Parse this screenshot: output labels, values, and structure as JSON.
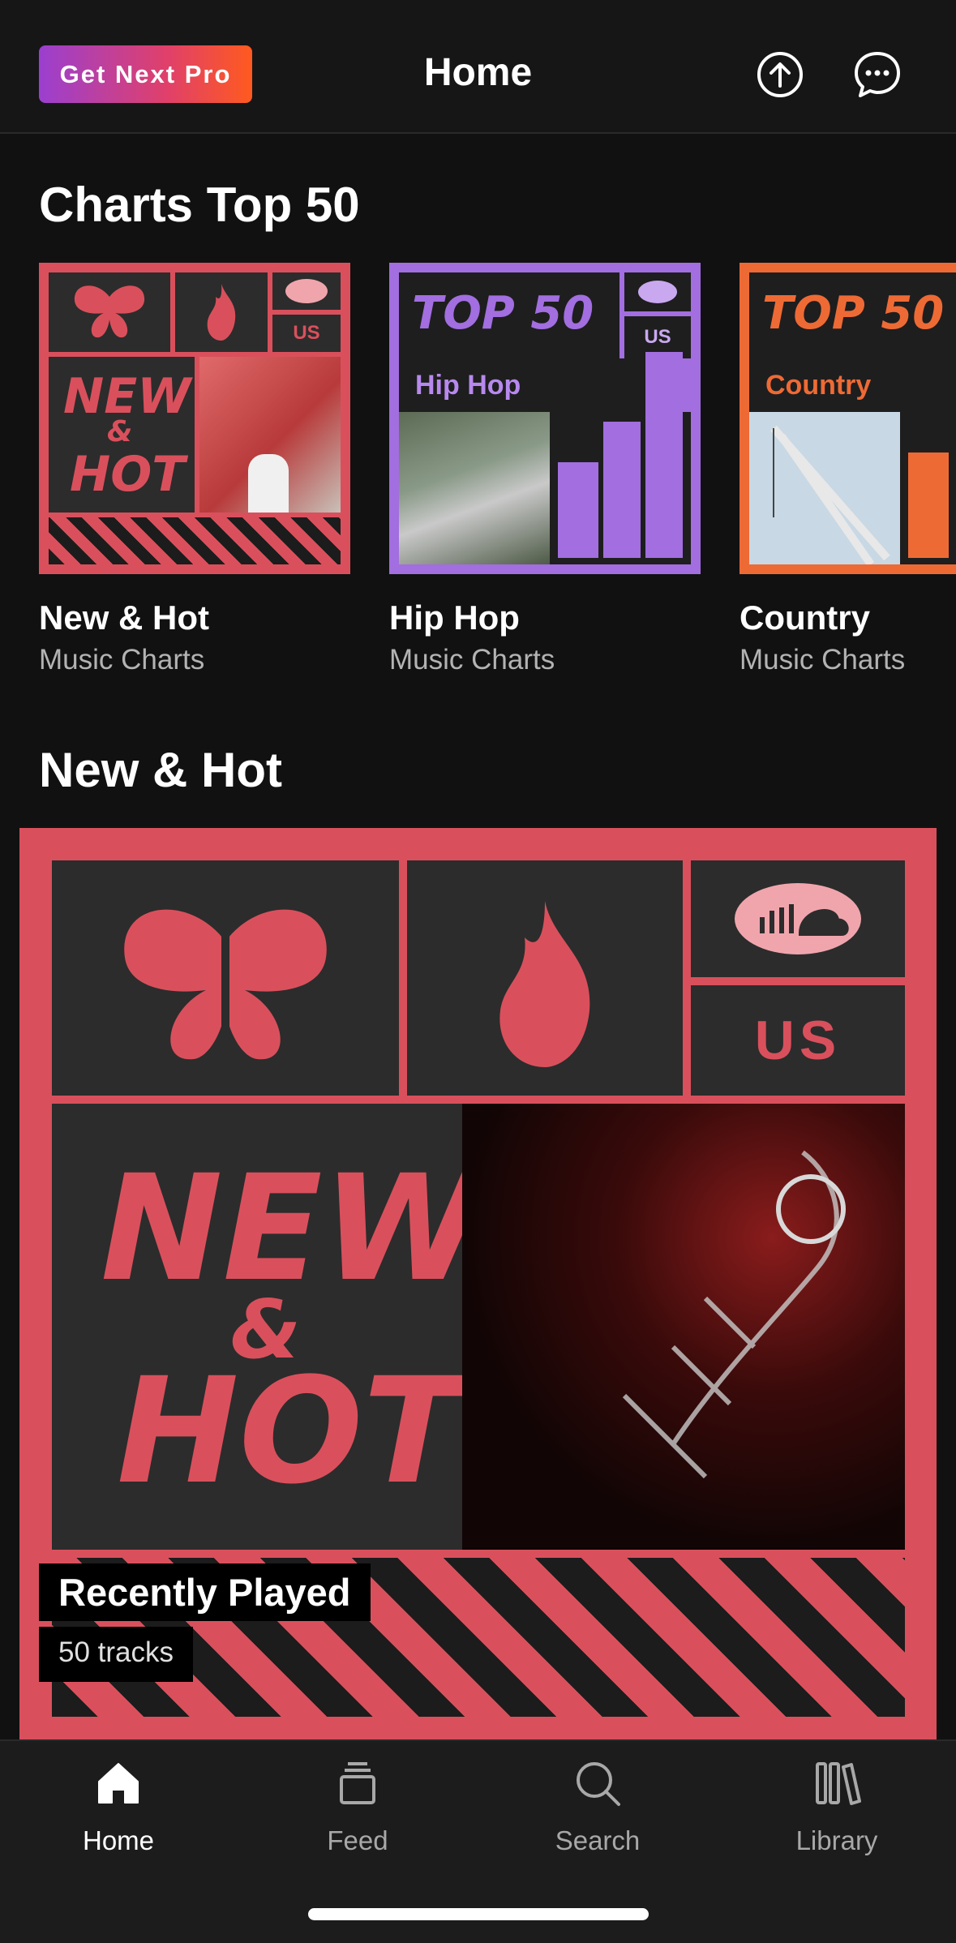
{
  "header": {
    "pro_button": "Get Next Pro",
    "title": "Home",
    "upload_icon": "upload-icon",
    "messages_icon": "chat-bubble-icon"
  },
  "charts_section": {
    "title": "Charts Top 50",
    "cards": [
      {
        "title": "New & Hot",
        "subtitle": "Music Charts",
        "art": {
          "l1": "NEW",
          "l2": "&",
          "l3": "HOT",
          "region": "US"
        }
      },
      {
        "title": "Hip Hop",
        "subtitle": "Music Charts",
        "art": {
          "top": "TOP 50",
          "genre": "Hip Hop",
          "region": "US"
        }
      },
      {
        "title": "Country",
        "subtitle": "Music Charts",
        "art": {
          "top": "TOP 50",
          "genre": "Country"
        }
      }
    ]
  },
  "new_hot_section": {
    "title": "New & Hot",
    "hero": {
      "art": {
        "l1": "NEW",
        "l2": "&",
        "l3": "HOT",
        "region": "US"
      },
      "label": "Recently Played",
      "tracks": "50 tracks"
    }
  },
  "tabbar": {
    "tabs": [
      {
        "label": "Home",
        "icon": "home-icon",
        "active": true
      },
      {
        "label": "Feed",
        "icon": "stack-icon",
        "active": false
      },
      {
        "label": "Search",
        "icon": "search-icon",
        "active": false
      },
      {
        "label": "Library",
        "icon": "library-icon",
        "active": false
      }
    ]
  },
  "colors": {
    "background": "#111111",
    "new_hot_pink": "#d9505c",
    "hiphop_purple": "#a26ee0",
    "country_orange": "#ee6a35"
  }
}
